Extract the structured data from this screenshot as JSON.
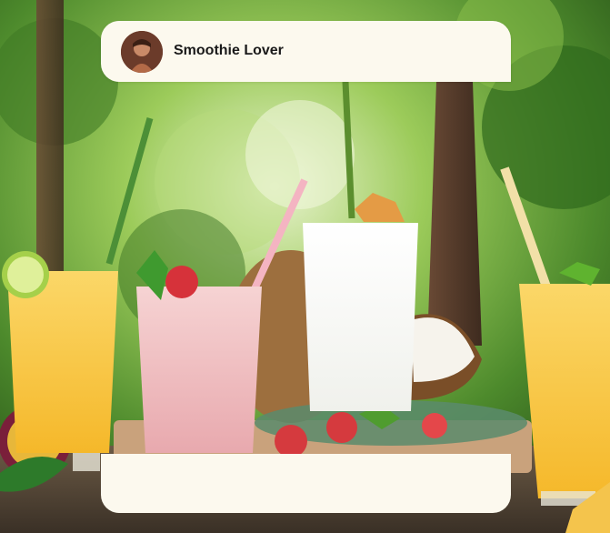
{
  "post": {
    "author_name": "Smoothie Lover",
    "avatar_icon": "user-avatar-photo",
    "caption": ""
  },
  "image": {
    "subject": "tropical-smoothies-photo"
  },
  "colors": {
    "card_background": "#fcf9ee",
    "author_text": "#1a1a1a"
  }
}
